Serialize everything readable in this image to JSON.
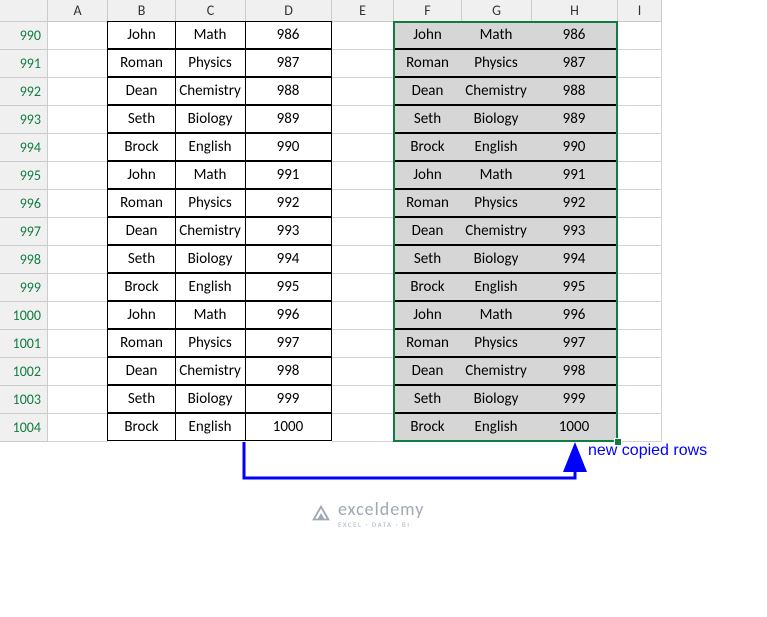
{
  "columns": [
    "A",
    "B",
    "C",
    "D",
    "E",
    "F",
    "G",
    "H",
    "I"
  ],
  "row_headers": [
    "990",
    "991",
    "992",
    "993",
    "994",
    "995",
    "996",
    "997",
    "998",
    "999",
    "1000",
    "1001",
    "1002",
    "1003",
    "1004"
  ],
  "table1": [
    [
      "John",
      "Math",
      "986"
    ],
    [
      "Roman",
      "Physics",
      "987"
    ],
    [
      "Dean",
      "Chemistry",
      "988"
    ],
    [
      "Seth",
      "Biology",
      "989"
    ],
    [
      "Brock",
      "English",
      "990"
    ],
    [
      "John",
      "Math",
      "991"
    ],
    [
      "Roman",
      "Physics",
      "992"
    ],
    [
      "Dean",
      "Chemistry",
      "993"
    ],
    [
      "Seth",
      "Biology",
      "994"
    ],
    [
      "Brock",
      "English",
      "995"
    ],
    [
      "John",
      "Math",
      "996"
    ],
    [
      "Roman",
      "Physics",
      "997"
    ],
    [
      "Dean",
      "Chemistry",
      "998"
    ],
    [
      "Seth",
      "Biology",
      "999"
    ],
    [
      "Brock",
      "English",
      "1000"
    ]
  ],
  "table2": [
    [
      "John",
      "Math",
      "986"
    ],
    [
      "Roman",
      "Physics",
      "987"
    ],
    [
      "Dean",
      "Chemistry",
      "988"
    ],
    [
      "Seth",
      "Biology",
      "989"
    ],
    [
      "Brock",
      "English",
      "990"
    ],
    [
      "John",
      "Math",
      "991"
    ],
    [
      "Roman",
      "Physics",
      "992"
    ],
    [
      "Dean",
      "Chemistry",
      "993"
    ],
    [
      "Seth",
      "Biology",
      "994"
    ],
    [
      "Brock",
      "English",
      "995"
    ],
    [
      "John",
      "Math",
      "996"
    ],
    [
      "Roman",
      "Physics",
      "997"
    ],
    [
      "Dean",
      "Chemistry",
      "998"
    ],
    [
      "Seth",
      "Biology",
      "999"
    ],
    [
      "Brock",
      "English",
      "1000"
    ]
  ],
  "annotation": "new copied rows",
  "logo_text": "exceldemy",
  "logo_sub": "EXCEL · DATA · BI"
}
